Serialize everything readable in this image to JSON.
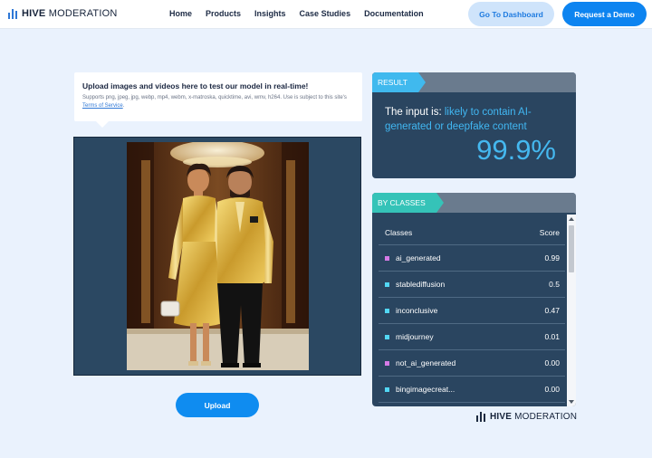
{
  "header": {
    "logo_bold": "HIVE",
    "logo_light": "MODERATION",
    "nav": [
      "Home",
      "Products",
      "Insights",
      "Case Studies",
      "Documentation"
    ],
    "dashboard_button": "Go To Dashboard",
    "demo_button": "Request a Demo"
  },
  "upload": {
    "title": "Upload images and videos here to test our model in real-time!",
    "formats_text": "Supports png, jpeg, jpg, webp, mp4, webm, x-matroska, quicktime, avi, wmv, h264. Use is subject to this site's",
    "terms_link": "Terms of Service",
    "terms_suffix": ".",
    "button": "Upload"
  },
  "result": {
    "tag": "RESULT",
    "prefix": "The input is:",
    "verdict": "likely to contain AI-generated or deepfake content",
    "percent": "99.9%"
  },
  "classes": {
    "tag": "BY CLASSES",
    "col_class": "Classes",
    "col_score": "Score",
    "rows": [
      {
        "name": "ai_generated",
        "score": "0.99",
        "color": "#d57ae6"
      },
      {
        "name": "stablediffusion",
        "score": "0.5",
        "color": "#52d7f4"
      },
      {
        "name": "inconclusive",
        "score": "0.47",
        "color": "#52d7f4"
      },
      {
        "name": "midjourney",
        "score": "0.01",
        "color": "#52d7f4"
      },
      {
        "name": "not_ai_generated",
        "score": "0.00",
        "color": "#d57ae6"
      },
      {
        "name": "bingimagecreat...",
        "score": "0.00",
        "color": "#52d7f4"
      }
    ]
  },
  "footer": {
    "logo_bold": "HIVE",
    "logo_light": "MODERATION"
  },
  "colors": {
    "accent_blue": "#0d84f0",
    "panel": "#2a4560",
    "result_tag": "#40b9ee",
    "classes_tag": "#35c3b8"
  }
}
